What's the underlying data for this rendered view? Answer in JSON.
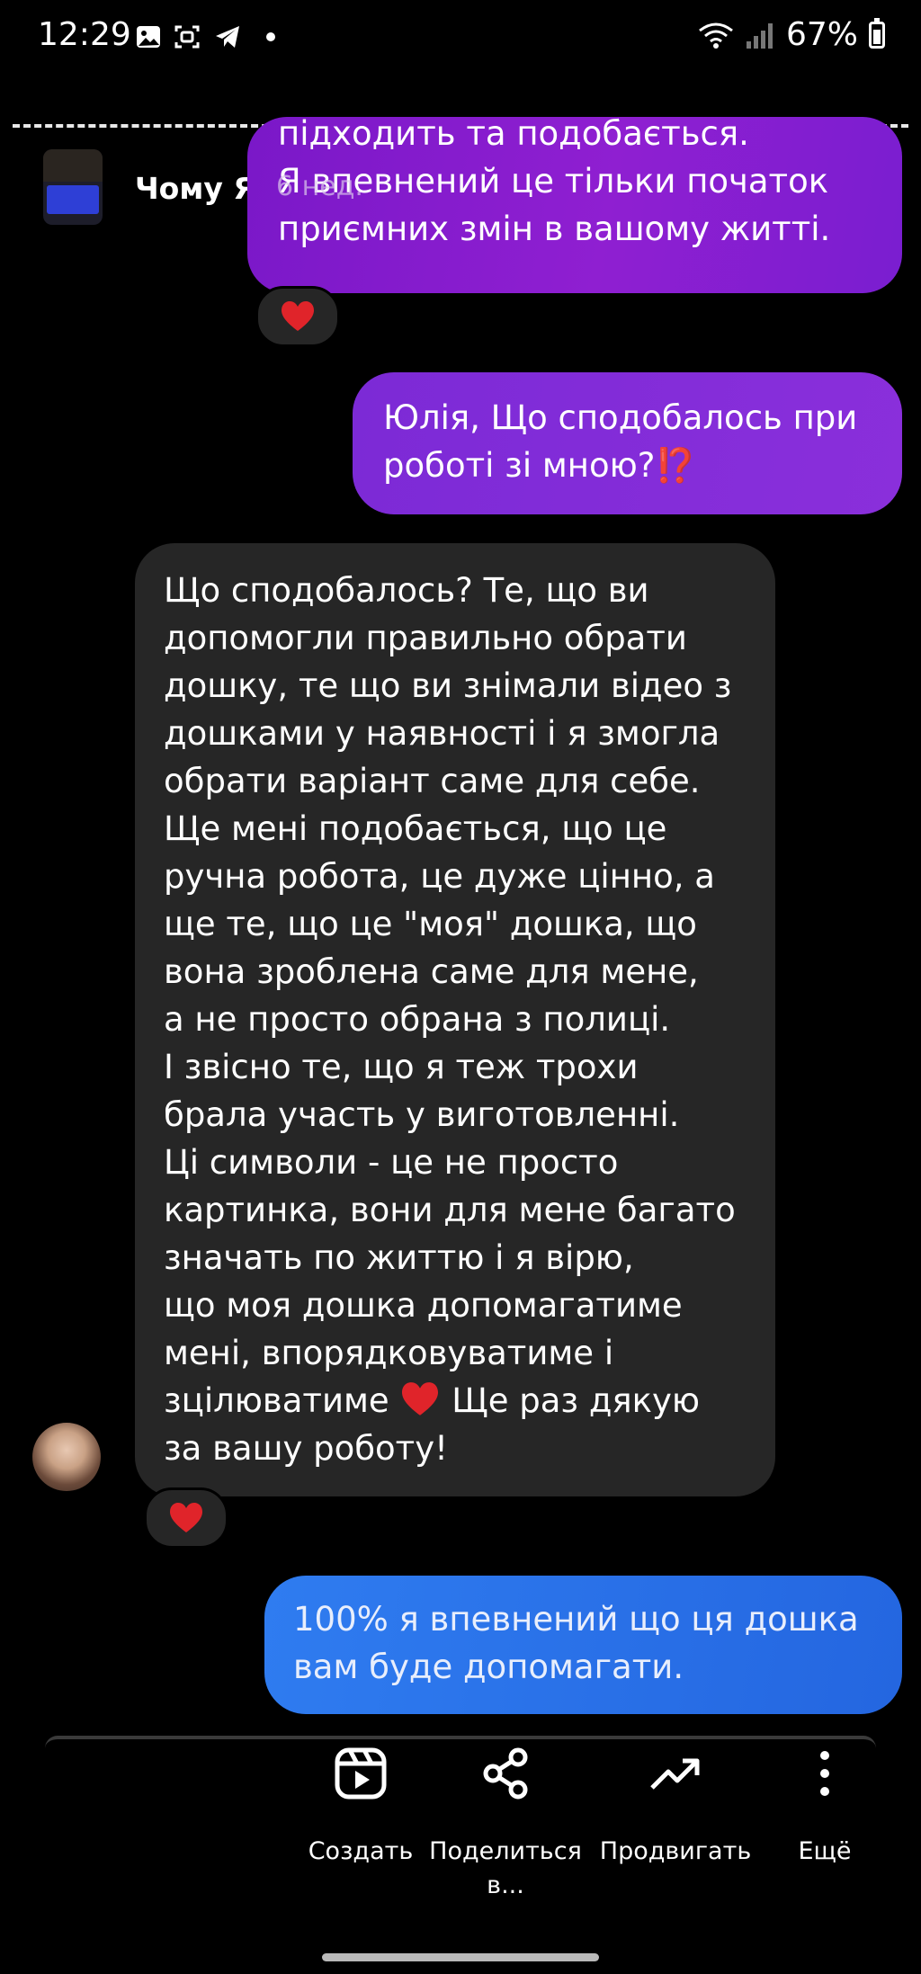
{
  "status_bar": {
    "time": "12:29",
    "battery": "67%",
    "battery_level": 0.67
  },
  "story": {
    "title": "Чому Я?",
    "age": "6 нед."
  },
  "messages": {
    "m1": {
      "lines": [
        "підходить та подобається.",
        "Я впевнений це тільки початок",
        "приємних змін в вашому житті."
      ],
      "reaction": "❤"
    },
    "m2": {
      "lines": [
        "Юлія, Що сподобалось при",
        "роботі зі мною?"
      ],
      "emoji": "⁉️"
    },
    "m3": {
      "lines": [
        "Що сподобалось? Те, що ви",
        "допомогли правильно обрати",
        "дошку, те що ви знімали відео з",
        "дошками у наявності і я змогла",
        "обрати варіант саме для себе.",
        "Ще мені подобається, що це",
        "ручна робота, це дуже цінно, а",
        "ще те, що це \"моя\" дошка, що",
        "вона зроблена саме для мене,",
        "а не просто обрана з полиці.",
        "І звісно те, що я теж трохи",
        "брала участь у виготовленні.",
        "Ці символи - це не просто",
        "картинка, вони для мене багато",
        "значать по життю і я вірю,",
        "що моя дошка допомагатиме",
        "мені, впорядковуватиме і"
      ],
      "line_18_before": "зцілюватиме",
      "line_18_after": "Ще раз дякую",
      "line_19": "за вашу роботу!",
      "reaction": "❤"
    },
    "m4": {
      "lines": [
        "100% я впевнений що ця дошка",
        "вам буде допомагати."
      ]
    }
  },
  "actions": [
    {
      "label": "Создать",
      "icon": "reels-icon"
    },
    {
      "label": "Поделиться в...",
      "label_line1": "Поделиться",
      "label_line2": "в...",
      "icon": "share-icon"
    },
    {
      "label": "Продвигать",
      "icon": "trending-icon"
    },
    {
      "label": "Ещё",
      "icon": "more-vertical-icon"
    }
  ],
  "colors": {
    "background": "#000000",
    "outgoing_purple": "#8a1fd0",
    "outgoing_blue": "#2a70e8",
    "incoming": "#262626",
    "heart": "#e0242a"
  }
}
